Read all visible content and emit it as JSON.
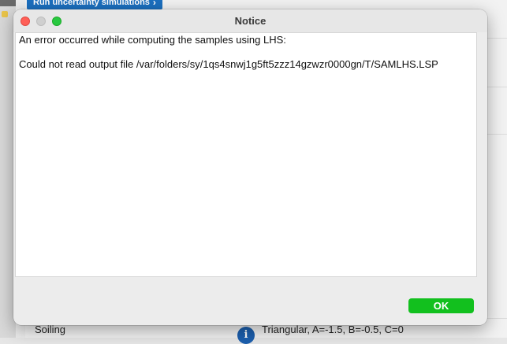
{
  "background_app": {
    "run_button_label": "Run uncertainty simulations",
    "row": {
      "label": "Soiling",
      "value": "Triangular, A=-1.5, B=-0.5, C=0"
    }
  },
  "dialog": {
    "title": "Notice",
    "message_line_1": "An error occurred while computing the samples using LHS:",
    "message_line_2": "Could not read output file /var/folders/sy/1qs4snwj1g5ft5zzz14gzwzr0000gn/T/SAMLHS.LSP",
    "ok_label": "OK"
  },
  "colors": {
    "ok_button": "#12c01e",
    "run_button": "#1b6fbf",
    "close_light": "#ff5f57",
    "zoom_light": "#28c840"
  }
}
